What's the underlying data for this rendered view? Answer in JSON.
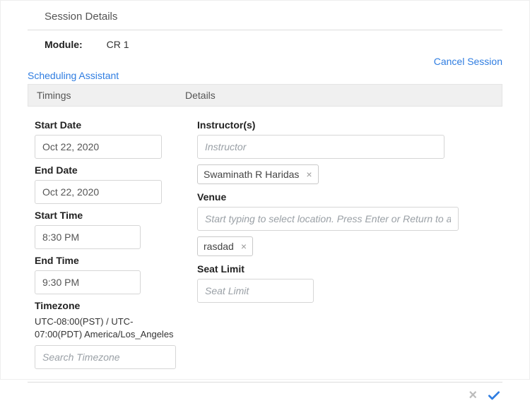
{
  "header": {
    "title": "Session Details"
  },
  "module": {
    "label": "Module:",
    "value": "CR 1"
  },
  "actions": {
    "cancel": "Cancel Session",
    "scheduling": "Scheduling Assistant"
  },
  "section_headers": {
    "timings": "Timings",
    "details": "Details"
  },
  "timings": {
    "start_date_label": "Start Date",
    "start_date_value": "Oct 22, 2020",
    "end_date_label": "End Date",
    "end_date_value": "Oct 22, 2020",
    "start_time_label": "Start Time",
    "start_time_value": "8:30 PM",
    "end_time_label": "End Time",
    "end_time_value": "9:30 PM",
    "timezone_label": "Timezone",
    "timezone_text": "UTC-08:00(PST) / UTC-07:00(PDT) America/Los_Angeles",
    "timezone_placeholder": "Search Timezone"
  },
  "details": {
    "instructors_label": "Instructor(s)",
    "instructor_placeholder": "Instructor",
    "instructor_chip": "Swaminath R Haridas",
    "venue_label": "Venue",
    "venue_placeholder": "Start typing to select location. Press Enter or Return to add n",
    "venue_chip": "rasdad",
    "seat_limit_label": "Seat Limit",
    "seat_limit_placeholder": "Seat Limit"
  },
  "icons": {
    "remove": "×",
    "close": "×"
  }
}
